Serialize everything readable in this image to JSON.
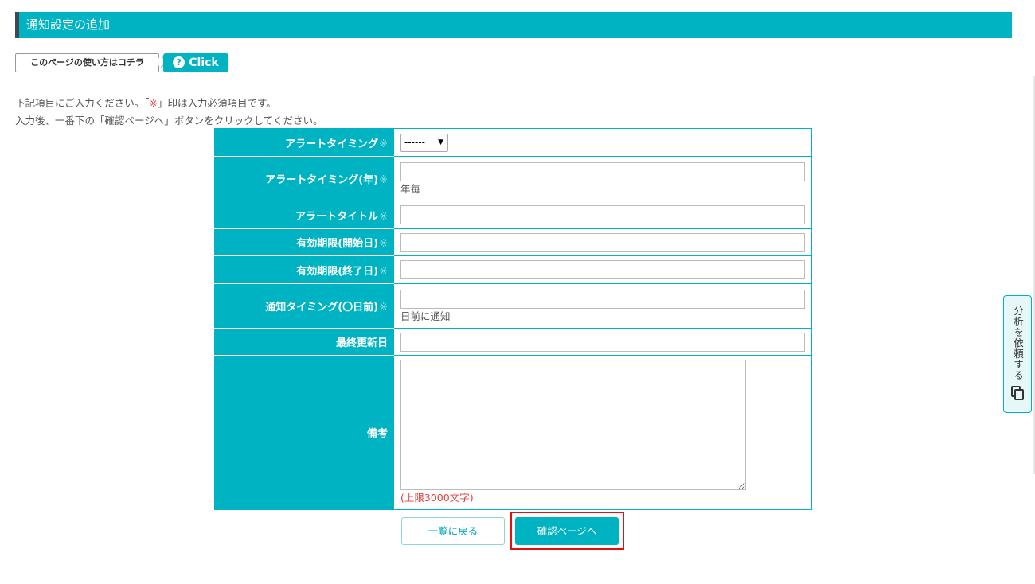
{
  "header": {
    "title": "通知設定の追加"
  },
  "help": {
    "label": "このページの使い方はコチラ",
    "click_label": "Click"
  },
  "intro": {
    "line1_prefix": "下記項目にご入力ください。「",
    "required_mark": "※",
    "line1_suffix": "」印は入力必須項目です。",
    "line2": "入力後、一番下の「確認ページへ」ボタンをクリックしてください。"
  },
  "form": {
    "required_mark": "※",
    "fields": {
      "alert_timing": {
        "label": "アラートタイミング",
        "value": "------"
      },
      "alert_timing_year": {
        "label": "アラートタイミング(年)",
        "value": "",
        "note": "年毎"
      },
      "alert_title": {
        "label": "アラートタイトル",
        "value": ""
      },
      "valid_start": {
        "label": "有効期限(開始日)",
        "value": ""
      },
      "valid_end": {
        "label": "有効期限(終了日)",
        "value": ""
      },
      "notify_timing": {
        "label": "通知タイミング(〇日前)",
        "value": "",
        "note": "日前に通知"
      },
      "last_updated": {
        "label": "最終更新日",
        "value": ""
      },
      "remarks": {
        "label": "備考",
        "value": "",
        "limit": "(上限3000文字)"
      }
    }
  },
  "buttons": {
    "back": "一覧に戻る",
    "confirm": "確認ページへ"
  },
  "side_tab": {
    "label": "分析を依頼する",
    "icon": "copy-icon"
  },
  "colors": {
    "accent": "#00b3c2",
    "required": "#e04040",
    "highlight": "#e21111"
  }
}
